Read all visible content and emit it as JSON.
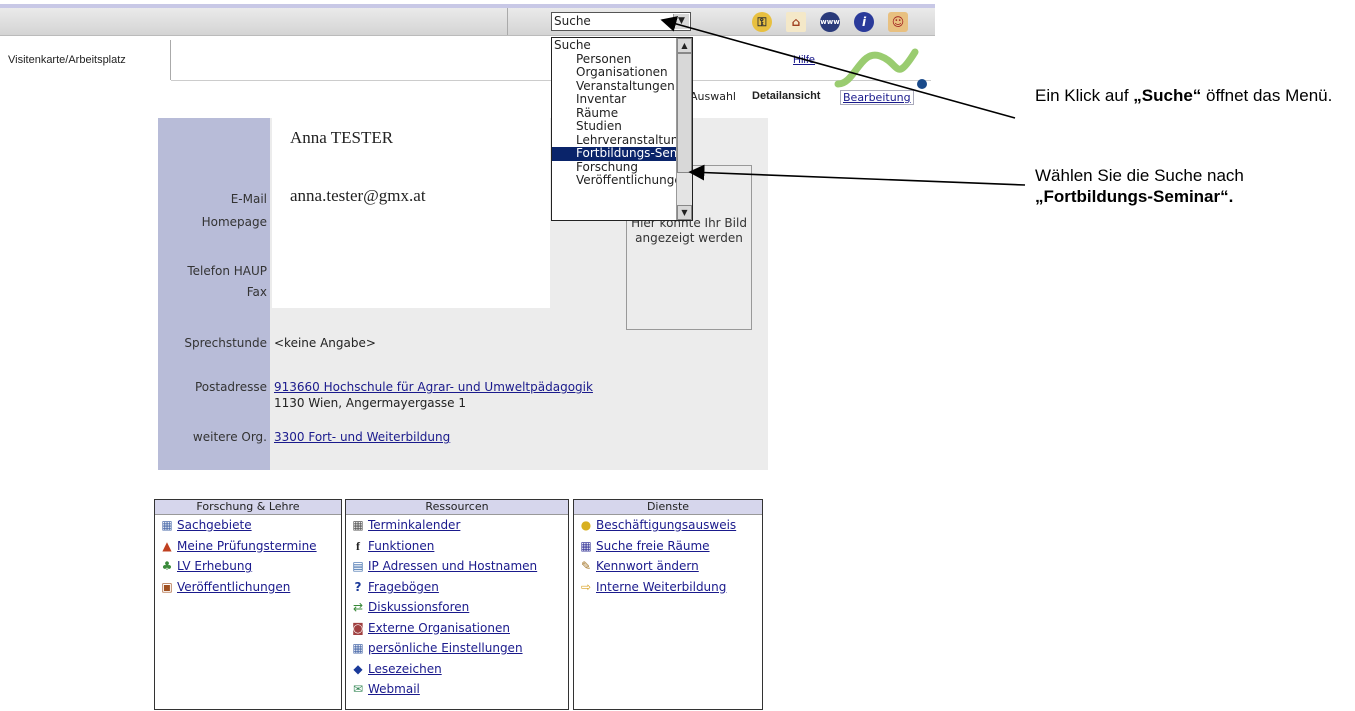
{
  "toolbar": {
    "search_select": "Suche",
    "icons": [
      "key-icon",
      "home-icon",
      "www-icon",
      "info-icon",
      "people-icon"
    ]
  },
  "tabs": {
    "visitenkarte": "Visitenkarte/Arbeitsplatz",
    "hilfe": "Hilfe",
    "auswahl": "Auswahl",
    "detailansicht": "Detailansicht",
    "bearbeitung": "Bearbeitung"
  },
  "dropdown": {
    "items": [
      "Suche",
      "Personen",
      "Organisationen",
      "Veranstaltungen",
      "Inventar",
      "Räume",
      "Studien",
      "Lehrveranstaltungen",
      "Fortbildungs-Seminar",
      "Forschung",
      "Veröffentlichungen"
    ],
    "highlighted": "Fortbildungs-Seminar"
  },
  "profile": {
    "name": "Anna TESTER",
    "email_label": "E-Mail",
    "email": "anna.tester@gmx.at",
    "homepage_label": "Homepage",
    "telefon_label": "Telefon HAUP",
    "fax_label": "Fax",
    "photo_text": "Hier könnte Ihr Bild angezeigt werden",
    "sprechstunde_label": "Sprechstunde",
    "sprechstunde": "<keine Angabe>",
    "postadresse_label": "Postadresse",
    "postadresse_link": "913660 Hochschule für Agrar- und Umweltpädagogik",
    "postadresse_street": "1130 Wien, Angermayergasse 1",
    "weitere_org_label": "weitere Org.",
    "weitere_org": "3300 Fort- und Weiterbildung"
  },
  "annotations": {
    "note1_pre": "Ein Klick auf ",
    "note1_bold": "„Suche“",
    "note1_post": " öffnet das Menü.",
    "note2_pre": "Wählen Sie die Suche nach ",
    "note2_bold": "„Fortbildungs-Seminar“."
  },
  "boxes": [
    {
      "title": "Forschung & Lehre",
      "items": [
        {
          "icon": "▦",
          "label": "Sachgebiete"
        },
        {
          "icon": "▲",
          "label": "Meine Prüfungstermine"
        },
        {
          "icon": "♣",
          "label": "LV Erhebung"
        },
        {
          "icon": "▣",
          "label": "Veröffentlichungen"
        }
      ]
    },
    {
      "title": "Ressourcen",
      "items": [
        {
          "icon": "▦",
          "label": "Terminkalender"
        },
        {
          "icon": "f",
          "label": "Funktionen"
        },
        {
          "icon": "▤",
          "label": "IP Adressen und Hostnamen"
        },
        {
          "icon": "?",
          "label": "Fragebögen"
        },
        {
          "icon": "⇄",
          "label": "Diskussionsforen"
        },
        {
          "icon": "◙",
          "label": "Externe Organisationen"
        },
        {
          "icon": "▦",
          "label": "persönliche Einstellungen"
        },
        {
          "icon": "◆",
          "label": "Lesezeichen"
        },
        {
          "icon": "✉",
          "label": "Webmail"
        }
      ]
    },
    {
      "title": "Dienste",
      "items": [
        {
          "icon": "●",
          "label": "Beschäftigungsausweis"
        },
        {
          "icon": "▦",
          "label": "Suche freie Räume"
        },
        {
          "icon": "✎",
          "label": "Kennwort ändern"
        },
        {
          "icon": "⇨",
          "label": "Interne Weiterbildung"
        }
      ]
    }
  ]
}
